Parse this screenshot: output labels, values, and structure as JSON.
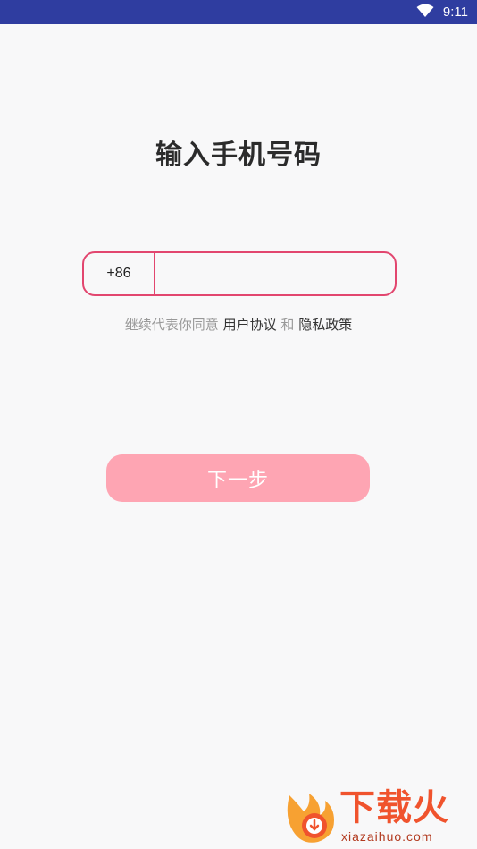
{
  "status_bar": {
    "time": "9:11",
    "wifi_icon": "wifi-icon",
    "background": "#2f3da0"
  },
  "title": "输入手机号码",
  "phone": {
    "country_code": "+86",
    "value": "",
    "placeholder": "",
    "accent": "#e2466f"
  },
  "agreement": {
    "prefix": "继续代表你同意",
    "terms_link": "用户协议",
    "conjunction": "和",
    "privacy_link": "隐私政策"
  },
  "next_button": {
    "label": "下一步",
    "color": "#fea5b3"
  },
  "watermark": {
    "brand": "下载火",
    "url": "xiazaihuo.com",
    "color": "#f0532d"
  }
}
